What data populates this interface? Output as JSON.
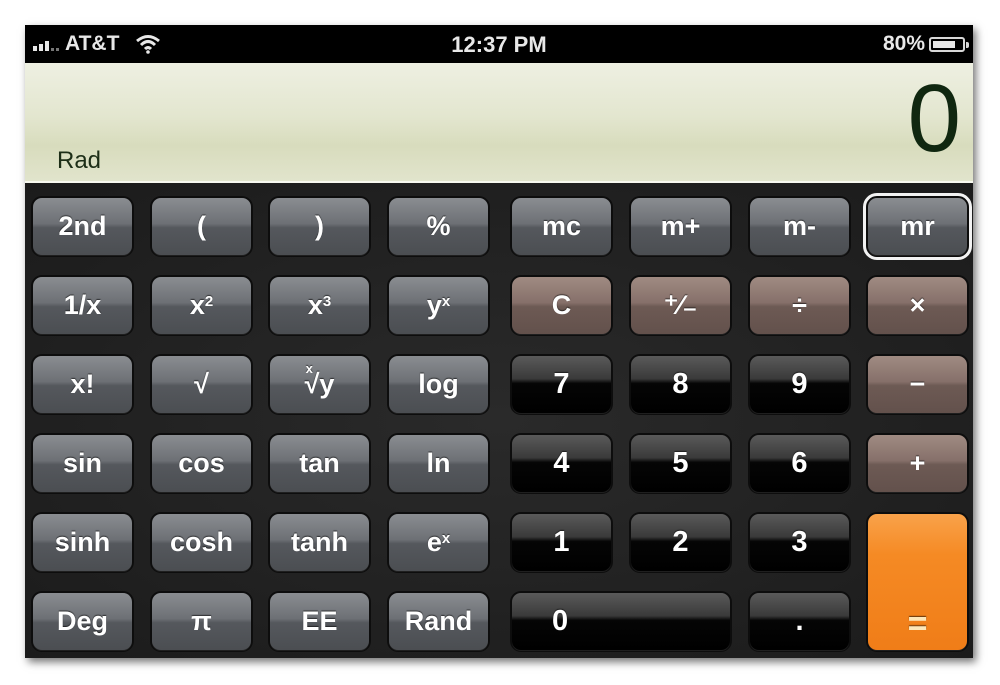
{
  "status_bar": {
    "carrier": "AT&T",
    "time": "12:37 PM",
    "battery_percent": "80%",
    "battery_level": 0.8,
    "signal_icon": "signal-bars-icon",
    "wifi_icon": "wifi-icon",
    "battery_icon": "battery-icon"
  },
  "display": {
    "mode": "Rad",
    "value": "0"
  },
  "colors": {
    "function_key": "#5f6267",
    "operator_key": "#7a655f",
    "number_key": "#000000",
    "equals_key": "#f58a24",
    "display_bg": "#e3e6cf",
    "display_text": "#102710"
  },
  "keys": {
    "second": "2nd",
    "open_paren": "(",
    "close_paren": ")",
    "percent": "%",
    "mc": "mc",
    "m_plus": "m+",
    "m_minus": "m-",
    "mr": "mr",
    "reciprocal": "1/x",
    "x_base": "x",
    "sq_exp": "2",
    "cube_exp": "3",
    "y_base": "y",
    "pow_exp": "x",
    "clear": "C",
    "plus_minus": "⁺∕₋",
    "divide": "÷",
    "multiply": "×",
    "factorial": "x!",
    "sqrt": "√",
    "root_index": "x",
    "root_radical": "√y",
    "log": "log",
    "seven": "7",
    "eight": "8",
    "nine": "9",
    "minus": "−",
    "sin": "sin",
    "cos": "cos",
    "tan": "tan",
    "ln": "ln",
    "four": "4",
    "five": "5",
    "six": "6",
    "plus": "+",
    "sinh": "sinh",
    "cosh": "cosh",
    "tanh": "tanh",
    "e_base": "e",
    "e_exp": "x",
    "one": "1",
    "two": "2",
    "three": "3",
    "equals": "=",
    "deg": "Deg",
    "pi": "π",
    "ee": "EE",
    "rand": "Rand",
    "zero": "0",
    "decimal": "."
  }
}
